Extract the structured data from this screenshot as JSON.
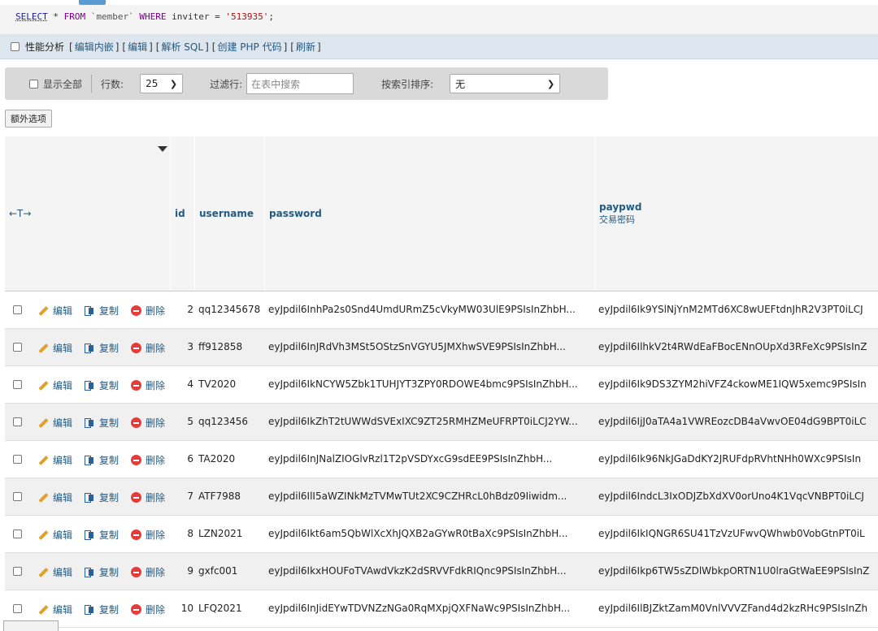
{
  "sql": {
    "select": "SELECT",
    "star": " * ",
    "from": "FROM",
    "table": " `member` ",
    "where": "WHERE",
    "col": " inviter = ",
    "value": "'513935'",
    "end": ";"
  },
  "links": {
    "perf": "性能分析",
    "open": "[",
    "close": "]",
    "edit_inline": "编辑内嵌",
    "edit": "编辑",
    "explain": "解析 SQL",
    "php": "创建 PHP 代码",
    "refresh": "刷新"
  },
  "toolbar": {
    "show_all": "显示全部",
    "rows_label": "行数:",
    "rows_value": "25",
    "filter_label": "过滤行:",
    "filter_placeholder": "在表中搜索",
    "sort_label": "按索引排序:",
    "sort_value": "无"
  },
  "extra_options": "额外选项",
  "columns": {
    "arrows": "←T→",
    "id": "id",
    "username": "username",
    "password": "password",
    "paypwd": "paypwd",
    "paypwd_comment": "交易密码"
  },
  "actions": {
    "edit": "编辑",
    "copy": "复制",
    "delete": "删除"
  },
  "rows": [
    {
      "id": "2",
      "username": "qq12345678",
      "password": "eyJpdil6InhPa2s0Snd4UmdURmZ5cVkyMW03UlE9PSIsInZhbH...",
      "paypwd": "eyJpdil6Ik9YSlNjYnM2MTd6XC8wUEFtdnJhR2V3PT0iLCJ"
    },
    {
      "id": "3",
      "username": "ff912858",
      "password": "eyJpdil6InJRdVh3MSt5OStzSnVGYU5JMXhwSVE9PSIsInZhbH...",
      "paypwd": "eyJpdil6IlhkV2t4RWdEaFBocENnOUpXd3RFeXc9PSIsInZ"
    },
    {
      "id": "4",
      "username": "TV2020",
      "password": "eyJpdil6IkNCYW5Zbk1TUHJYT3ZPY0RDOWE4bmc9PSIsInZhbH...",
      "paypwd": "eyJpdil6Ik9DS3ZYM2hiVFZ4ckowME1IQW5xemc9PSIsIn"
    },
    {
      "id": "5",
      "username": "qq123456",
      "password": "eyJpdil6IkZhT2tUWWdSVExIXC9ZT25RMHZMeUFRPT0iLCJ2YW...",
      "paypwd": "eyJpdil6IjJ0aTA4a1VWREozcDB4aVwvOE04dG9BPT0iLC"
    },
    {
      "id": "6",
      "username": "TA2020",
      "password": "eyJpdil6InJNalZIOGlvRzl1T2pVSDYxcG9sdEE9PSIsInZhbH...",
      "paypwd": "eyJpdil6Ik96NkJGaDdKY2JRUFdpRVhtNHh0WXc9PSIsIn"
    },
    {
      "id": "7",
      "username": "ATF7988",
      "password": "eyJpdil6IlI5aWZINkMzTVMwTUt2XC9CZHRcL0hBdz09Iiwidm...",
      "paypwd": "eyJpdil6IndcL3IxODJZbXdXV0orUno4K1VqcVNBPT0iLCJ"
    },
    {
      "id": "8",
      "username": "LZN2021",
      "password": "eyJpdil6Ikt6am5QbWlXcXhJQXB2aGYwR0tBaXc9PSIsInZhbH...",
      "paypwd": "eyJpdil6IkIQNGR6SU41TzVzUFwvQWhwb0VobGtnPT0iL"
    },
    {
      "id": "9",
      "username": "gxfc001",
      "password": "eyJpdil6IkxHOUFoTVAwdVkzK2dSRVVFdkRIQnc9PSIsInZhbH...",
      "paypwd": "eyJpdil6Ikp6TW5sZDlWbkpORTN1U0lraGtWaEE9PSIsInZ"
    },
    {
      "id": "10",
      "username": "LFQ2021",
      "password": "eyJpdil6InJidEYwTDVNZzNGa0RqMXpjQXFNaWc9PSIsInZhbH...",
      "paypwd": "eyJpdil6IlBJZktZamM0VnlVVVZFand4d2kzRHc9PSIsInZh"
    }
  ]
}
